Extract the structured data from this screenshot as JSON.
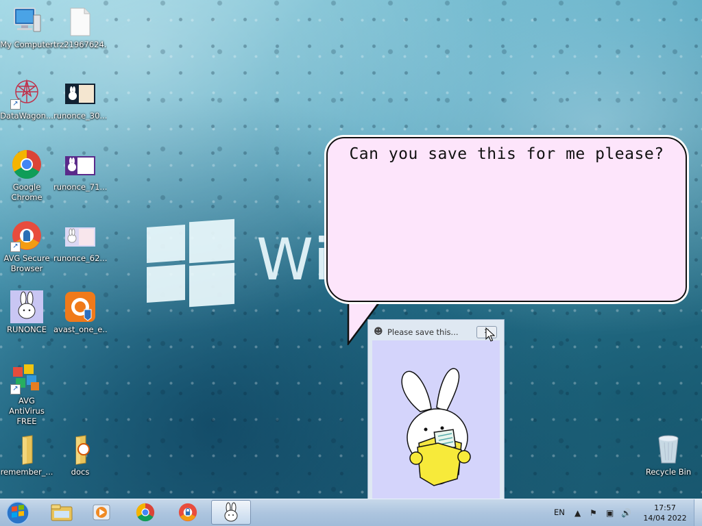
{
  "desktop": {
    "icons": [
      {
        "label": "My Computer",
        "icon": "computer-icon"
      },
      {
        "label": "trz21967624...",
        "icon": "document-icon"
      },
      {
        "label": "DataWagon...",
        "icon": "datawagon-icon"
      },
      {
        "label": "runonce_30...",
        "icon": "image-icon"
      },
      {
        "label": "Google Chrome",
        "icon": "chrome-icon"
      },
      {
        "label": "runonce_71...",
        "icon": "image-icon"
      },
      {
        "label": "AVG Secure Browser",
        "icon": "avg-secure-browser-icon"
      },
      {
        "label": "runonce_62...",
        "icon": "image-icon"
      },
      {
        "label": "RUNONCE",
        "icon": "bunny-icon"
      },
      {
        "label": "avast_one_e...",
        "icon": "avast-icon"
      },
      {
        "label": "AVG AntiVirus FREE",
        "icon": "avg-antivirus-icon"
      },
      {
        "label": "remember_...",
        "icon": "folder-icon"
      },
      {
        "label": "docs",
        "icon": "folder-icon"
      },
      {
        "label": "Recycle Bin",
        "icon": "recycle-bin-icon"
      }
    ]
  },
  "wallpaper": {
    "text": "Wi"
  },
  "bubble": {
    "text": "Can you save this for me please?",
    "background": "#fde5fb"
  },
  "popup_window": {
    "title": "Please save this...",
    "close_label": "✕",
    "body_color": "#d4d4fb"
  },
  "taskbar": {
    "pinned": [
      "explorer-icon",
      "media-player-icon",
      "chrome-icon",
      "avg-secure-browser-icon",
      "bunny-icon"
    ],
    "language": "EN",
    "time": "17:57",
    "date": "14/04 2022"
  }
}
